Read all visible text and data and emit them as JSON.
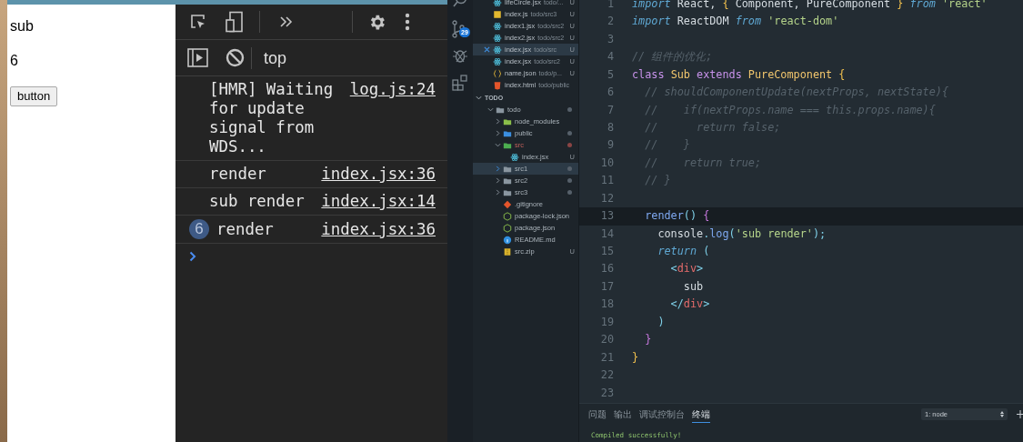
{
  "browser": {
    "texts": [
      "sub",
      "6"
    ],
    "button": "button"
  },
  "devtools": {
    "context": "top",
    "messages": [
      {
        "text": "[HMR] Waiting for update signal from WDS...",
        "source": "log.js:24"
      },
      {
        "text": "render",
        "source": "index.jsx:36"
      },
      {
        "text": "sub render",
        "source": "index.jsx:14"
      },
      {
        "text": "render",
        "source": "index.jsx:36",
        "count": "6"
      }
    ]
  },
  "activity_bar": {
    "badge": "29"
  },
  "open_editors": [
    {
      "kind": "react",
      "name": "lifeCircle.jsx",
      "path": "todo/...",
      "status": "U",
      "selected": false
    },
    {
      "kind": "js",
      "name": "index.js",
      "path": "todo/src3",
      "status": "U",
      "selected": false
    },
    {
      "kind": "react",
      "name": "index1.jsx",
      "path": "todo/src2",
      "status": "U",
      "selected": false
    },
    {
      "kind": "react",
      "name": "index2.jsx",
      "path": "todo/src2",
      "status": "U",
      "selected": false
    },
    {
      "kind": "react",
      "name": "index.jsx",
      "path": "todo/src",
      "status": "U",
      "selected": true
    },
    {
      "kind": "react",
      "name": "index.jsx",
      "path": "todo/src2",
      "status": "U",
      "selected": false
    },
    {
      "kind": "json",
      "name": "name.json",
      "path": "todo/p...",
      "status": "U",
      "selected": false
    },
    {
      "kind": "html",
      "name": "index.html",
      "path": "todo/public",
      "selected": false
    }
  ],
  "section_title": "TODO",
  "tree": [
    {
      "kind": "folder",
      "name": "todo",
      "expanded": true,
      "selected": false,
      "color": "#56606a",
      "children": [
        {
          "kind": "node-folder",
          "name": "node_modules",
          "expanded": false,
          "selected": false
        },
        {
          "kind": "public-folder",
          "name": "public",
          "expanded": false,
          "selected": false,
          "color": "#56606a"
        },
        {
          "kind": "src-folder",
          "name": "src",
          "expanded": true,
          "selected": false,
          "color": "#8a4444",
          "children": [
            {
              "kind": "react",
              "name": "index.jsx",
              "status": "U",
              "selected": false
            }
          ]
        },
        {
          "kind": "folder",
          "name": "src1",
          "expanded": false,
          "selected": true,
          "color": "#56606a"
        },
        {
          "kind": "folder",
          "name": "src2",
          "expanded": false,
          "selected": false,
          "color": "#56606a"
        },
        {
          "kind": "folder",
          "name": "src3",
          "expanded": false,
          "selected": false,
          "color": "#56606a"
        },
        {
          "kind": "git",
          "name": ".gitignore",
          "selected": false
        },
        {
          "kind": "node",
          "name": "package-lock.json",
          "selected": false
        },
        {
          "kind": "node",
          "name": "package.json",
          "selected": false
        },
        {
          "kind": "info",
          "name": "README.md",
          "selected": false
        },
        {
          "kind": "zip",
          "name": "src.zip",
          "status": "U",
          "selected": false
        }
      ]
    }
  ],
  "code": [
    {
      "number": "1",
      "current": false,
      "tokens": [
        {
          "kind": "keyword",
          "text": "import"
        },
        {
          "kind": "plain",
          "text": " React, "
        },
        {
          "kind": "brace",
          "text": "{"
        },
        {
          "kind": "plain",
          "text": " Component, PureComponent "
        },
        {
          "kind": "brace",
          "text": "}"
        },
        {
          "kind": "keyword",
          "text": " from"
        },
        {
          "kind": "string",
          "text": " 'react'"
        }
      ]
    },
    {
      "number": "2",
      "current": false,
      "tokens": [
        {
          "kind": "keyword",
          "text": "import"
        },
        {
          "kind": "plain",
          "text": " ReactDOM "
        },
        {
          "kind": "keyword",
          "text": "from"
        },
        {
          "kind": "string",
          "text": " 'react-dom'"
        }
      ]
    },
    {
      "number": "3",
      "current": false
    },
    {
      "number": "4",
      "current": false,
      "tokens": [
        {
          "kind": "comment",
          "text": "// 组件的优化;"
        }
      ]
    },
    {
      "number": "5",
      "current": false,
      "tokens": [
        {
          "kind": "storage",
          "text": "class "
        },
        {
          "kind": "class",
          "text": "Sub"
        },
        {
          "kind": "storage",
          "text": " extends "
        },
        {
          "kind": "class",
          "text": "PureComponent"
        },
        {
          "kind": "brace",
          "text": " {"
        }
      ]
    },
    {
      "number": "6",
      "current": false,
      "tokens": [
        {
          "kind": "comment",
          "text": "  // shouldComponentUpdate(nextProps, nextState){"
        }
      ]
    },
    {
      "number": "7",
      "current": false,
      "tokens": [
        {
          "kind": "comment",
          "text": "  //    if(nextProps.name === this.props.name){"
        }
      ]
    },
    {
      "number": "8",
      "current": false,
      "tokens": [
        {
          "kind": "comment",
          "text": "  //      return false;"
        }
      ]
    },
    {
      "number": "9",
      "current": false,
      "tokens": [
        {
          "kind": "comment",
          "text": "  //    }"
        }
      ]
    },
    {
      "number": "10",
      "current": false,
      "tokens": [
        {
          "kind": "comment",
          "text": "  //    return true;"
        }
      ]
    },
    {
      "number": "11",
      "current": false,
      "tokens": [
        {
          "kind": "comment",
          "text": "  // }"
        }
      ]
    },
    {
      "number": "12",
      "current": false
    },
    {
      "number": "13",
      "current": true,
      "tokens": [
        {
          "kind": "function",
          "text": "  render"
        },
        {
          "kind": "punct",
          "text": "()"
        },
        {
          "kind": "brace2",
          "text": " {"
        }
      ]
    },
    {
      "number": "14",
      "current": false,
      "tokens": [
        {
          "kind": "plain",
          "text": "    console"
        },
        {
          "kind": "punct",
          "text": "."
        },
        {
          "kind": "function",
          "text": "log"
        },
        {
          "kind": "punct",
          "text": "("
        },
        {
          "kind": "string",
          "text": "'sub render'"
        },
        {
          "kind": "punct",
          "text": ");"
        }
      ]
    },
    {
      "number": "15",
      "current": false,
      "tokens": [
        {
          "kind": "keyword",
          "text": "    return"
        },
        {
          "kind": "punct",
          "text": " ("
        }
      ]
    },
    {
      "number": "16",
      "current": false,
      "tokens": [
        {
          "kind": "punct",
          "text": "      <"
        },
        {
          "kind": "tag",
          "text": "div"
        },
        {
          "kind": "punct",
          "text": ">"
        }
      ]
    },
    {
      "number": "17",
      "current": false,
      "tokens": [
        {
          "kind": "plain",
          "text": "        sub"
        }
      ]
    },
    {
      "number": "18",
      "current": false,
      "tokens": [
        {
          "kind": "punct",
          "text": "      </"
        },
        {
          "kind": "tag",
          "text": "div"
        },
        {
          "kind": "punct",
          "text": ">"
        }
      ]
    },
    {
      "number": "19",
      "current": false,
      "tokens": [
        {
          "kind": "punct",
          "text": "    )"
        }
      ]
    },
    {
      "number": "20",
      "current": false,
      "tokens": [
        {
          "kind": "brace2",
          "text": "  }"
        }
      ]
    },
    {
      "number": "21",
      "current": false,
      "tokens": [
        {
          "kind": "brace",
          "text": "}"
        }
      ]
    },
    {
      "number": "22",
      "current": false
    },
    {
      "number": "23",
      "current": false
    }
  ],
  "panel": {
    "tabs": [
      {
        "label": "问题",
        "selected": false
      },
      {
        "label": "输出",
        "selected": false
      },
      {
        "label": "调试控制台",
        "selected": false
      },
      {
        "label": "终端",
        "selected": true
      }
    ],
    "terminal_select": "1: node",
    "output": "Compiled successfully!"
  }
}
